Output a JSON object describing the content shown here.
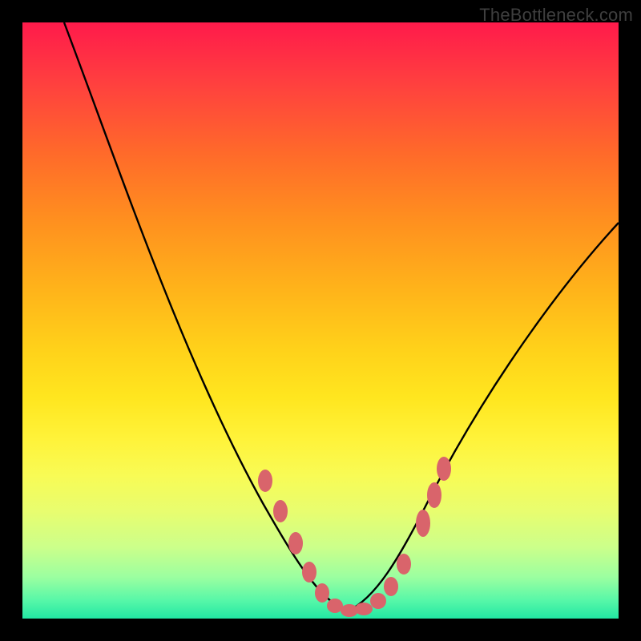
{
  "watermark": "TheBottleneck.com",
  "chart_data": {
    "type": "line",
    "title": "",
    "xlabel": "",
    "ylabel": "",
    "xlim": [
      0,
      100
    ],
    "ylim": [
      0,
      100
    ],
    "gradient_stops": [
      {
        "pct": 0,
        "color": "#ff1a4b"
      },
      {
        "pct": 10,
        "color": "#ff3f3f"
      },
      {
        "pct": 22,
        "color": "#ff6a2a"
      },
      {
        "pct": 33,
        "color": "#ff8f1f"
      },
      {
        "pct": 45,
        "color": "#ffb41a"
      },
      {
        "pct": 55,
        "color": "#ffd21a"
      },
      {
        "pct": 63,
        "color": "#ffe61f"
      },
      {
        "pct": 70,
        "color": "#fff33a"
      },
      {
        "pct": 76,
        "color": "#f8fb55"
      },
      {
        "pct": 82,
        "color": "#e8fd6f"
      },
      {
        "pct": 88,
        "color": "#ccff8a"
      },
      {
        "pct": 93,
        "color": "#9cffa0"
      },
      {
        "pct": 97,
        "color": "#56f7a8"
      },
      {
        "pct": 100,
        "color": "#22e7a3"
      }
    ],
    "series": [
      {
        "name": "bottleneck-curve",
        "x": [
          7,
          10,
          14,
          18,
          22,
          26,
          30,
          34,
          38,
          41,
          44,
          47,
          50,
          53,
          56,
          59,
          62,
          65,
          68,
          72,
          76,
          80,
          85,
          90,
          95,
          100
        ],
        "values": [
          100,
          92,
          84,
          76,
          67,
          58,
          49,
          40,
          31,
          23,
          16,
          10,
          5,
          2,
          1,
          1,
          2,
          5,
          10,
          17,
          25,
          34,
          44,
          53,
          61,
          68
        ]
      }
    ],
    "markers": {
      "name": "highlight-dots",
      "color": "#d9646b",
      "x": [
        41,
        44,
        47,
        49,
        51,
        53,
        55,
        57,
        59,
        61,
        63,
        66,
        68,
        70
      ],
      "values": [
        23,
        17,
        11,
        7,
        4,
        2,
        1,
        1,
        2,
        4,
        8,
        14,
        20,
        26
      ]
    }
  }
}
